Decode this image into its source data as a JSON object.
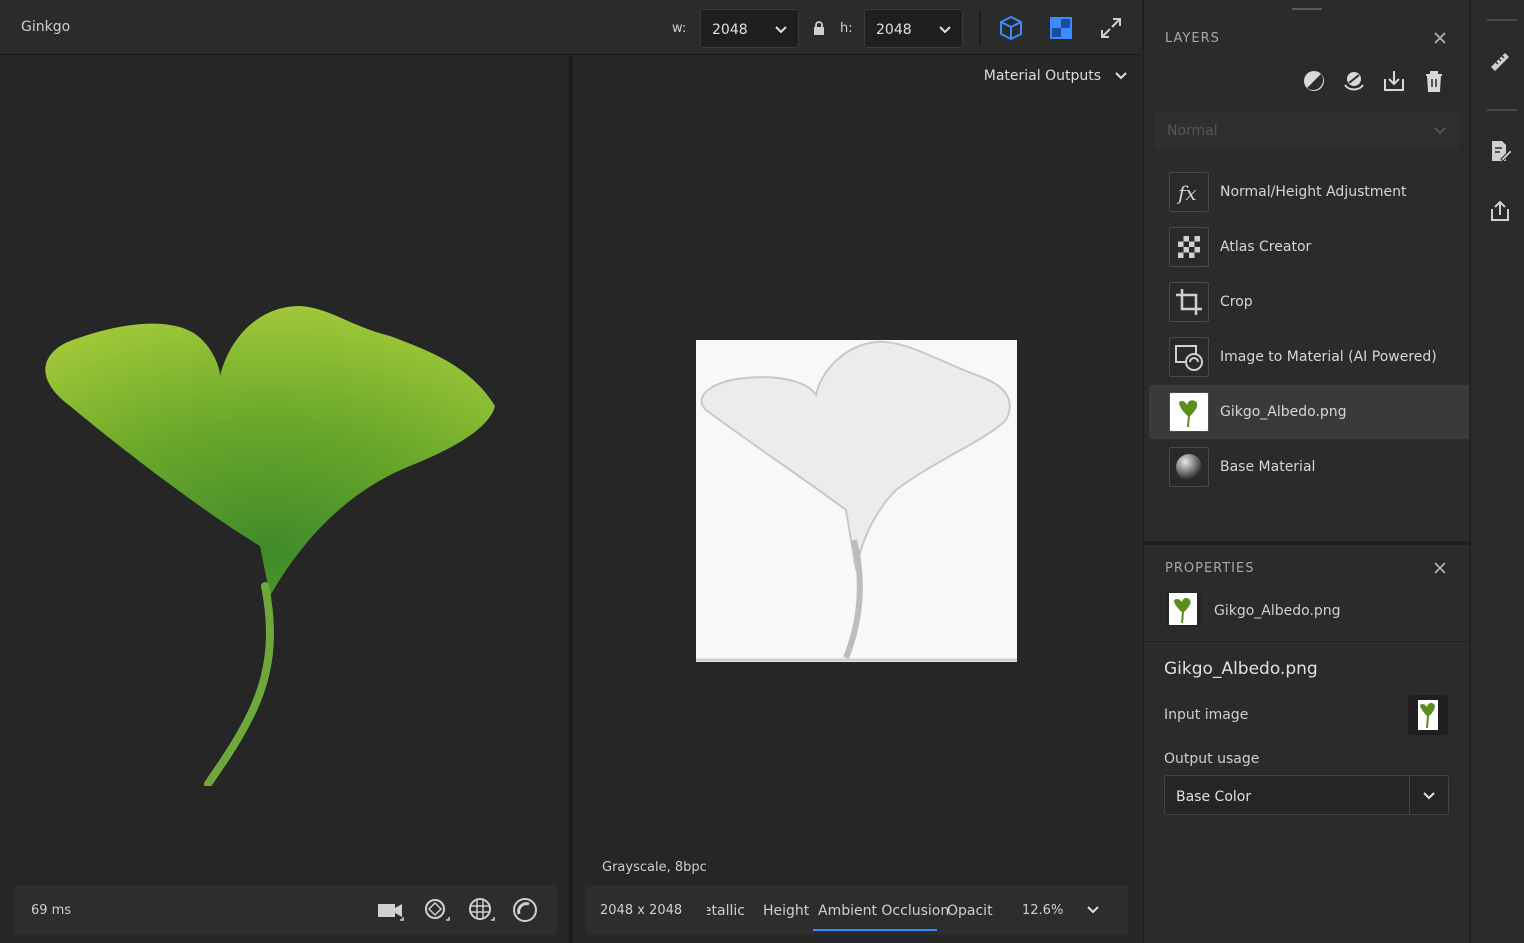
{
  "document": {
    "title": "Ginkgo"
  },
  "toolbar": {
    "width_label": "w:",
    "width_value": "2048",
    "height_label": "h:",
    "height_value": "2048",
    "icons": [
      "cube-icon",
      "2d-view-icon",
      "expand-icon"
    ]
  },
  "viewport3d": {
    "render_time": "69 ms",
    "tools": [
      "camera-icon",
      "environment-light-icon",
      "globe-grid-icon",
      "material-sphere-icon"
    ]
  },
  "viewport2d": {
    "outputs_label": "Material Outputs",
    "info": "Grayscale, 8bpc",
    "size": "2048 x 2048",
    "channels": [
      "letallic",
      "Height",
      "Ambient Occlusion",
      "Opacit"
    ],
    "active_channel": "Ambient Occlusion",
    "zoom": "12.6%"
  },
  "layers": {
    "title": "LAYERS",
    "tools": [
      "mask-icon",
      "fill-icon",
      "import-icon",
      "trash-icon"
    ],
    "blend_mode": "Normal",
    "items": [
      {
        "label": "Normal/Height Adjustment",
        "icon": "fx-icon"
      },
      {
        "label": "Atlas Creator",
        "icon": "checker-icon"
      },
      {
        "label": "Crop",
        "icon": "crop-icon"
      },
      {
        "label": "Image to Material (AI Powered)",
        "icon": "image-material-icon"
      },
      {
        "label": "Gikgo_Albedo.png",
        "icon": "ginkgo-thumb",
        "selected": true
      },
      {
        "label": "Base Material",
        "icon": "sphere-icon"
      }
    ]
  },
  "properties": {
    "title": "PROPERTIES",
    "layer_name": "Gikgo_Albedo.png",
    "heading": "Gikgo_Albedo.png",
    "input_image_label": "Input image",
    "output_usage_label": "Output usage",
    "output_usage_value": "Base Color"
  },
  "colors": {
    "accent": "#3a8bff",
    "leaf": "#7fb82a"
  }
}
